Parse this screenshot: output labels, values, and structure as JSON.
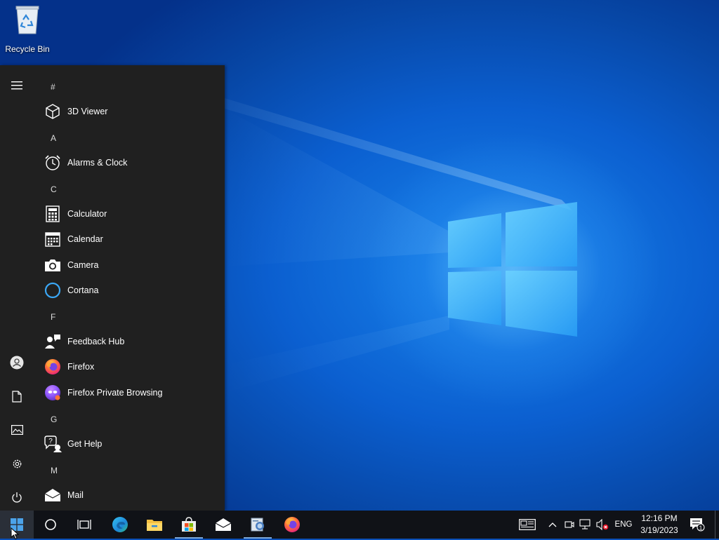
{
  "desktop": {
    "icons": [
      {
        "label": "Recycle Bin",
        "icon": "recycle-bin-icon"
      }
    ]
  },
  "start_menu": {
    "rail": [
      {
        "icon": "hamburger-menu-icon"
      },
      {
        "icon": "user-account-icon"
      },
      {
        "icon": "documents-icon"
      },
      {
        "icon": "pictures-icon"
      },
      {
        "icon": "settings-gear-icon"
      },
      {
        "icon": "power-icon"
      }
    ],
    "groups": [
      {
        "letter": "#",
        "apps": [
          {
            "name": "3D Viewer",
            "icon": "cube-icon"
          }
        ]
      },
      {
        "letter": "A",
        "apps": [
          {
            "name": "Alarms & Clock",
            "icon": "alarm-clock-icon"
          }
        ]
      },
      {
        "letter": "C",
        "apps": [
          {
            "name": "Calculator",
            "icon": "calculator-icon"
          },
          {
            "name": "Calendar",
            "icon": "calendar-icon"
          },
          {
            "name": "Camera",
            "icon": "camera-icon"
          },
          {
            "name": "Cortana",
            "icon": "cortana-ring-icon"
          }
        ]
      },
      {
        "letter": "F",
        "apps": [
          {
            "name": "Feedback Hub",
            "icon": "feedback-hub-icon"
          },
          {
            "name": "Firefox",
            "icon": "firefox-icon"
          },
          {
            "name": "Firefox Private Browsing",
            "icon": "firefox-private-icon"
          }
        ]
      },
      {
        "letter": "G",
        "apps": [
          {
            "name": "Get Help",
            "icon": "get-help-icon"
          }
        ]
      },
      {
        "letter": "M",
        "apps": [
          {
            "name": "Mail",
            "icon": "mail-icon"
          }
        ]
      }
    ]
  },
  "taskbar": {
    "pinned": [
      {
        "icon": "windows-start-icon"
      },
      {
        "icon": "cortana-search-icon"
      },
      {
        "icon": "task-view-icon"
      },
      {
        "icon": "edge-icon"
      },
      {
        "icon": "file-explorer-icon"
      },
      {
        "icon": "store-icon"
      },
      {
        "icon": "mail-icon"
      },
      {
        "icon": "app-icon"
      },
      {
        "icon": "firefox-icon"
      }
    ],
    "tray": {
      "language": "ENG",
      "time": "12:16 PM",
      "date": "3/19/2023",
      "notification_count": "1"
    }
  },
  "colors": {
    "start_bg": "#202020",
    "taskbar_bg": "#101217",
    "accent": "#0078d7"
  }
}
